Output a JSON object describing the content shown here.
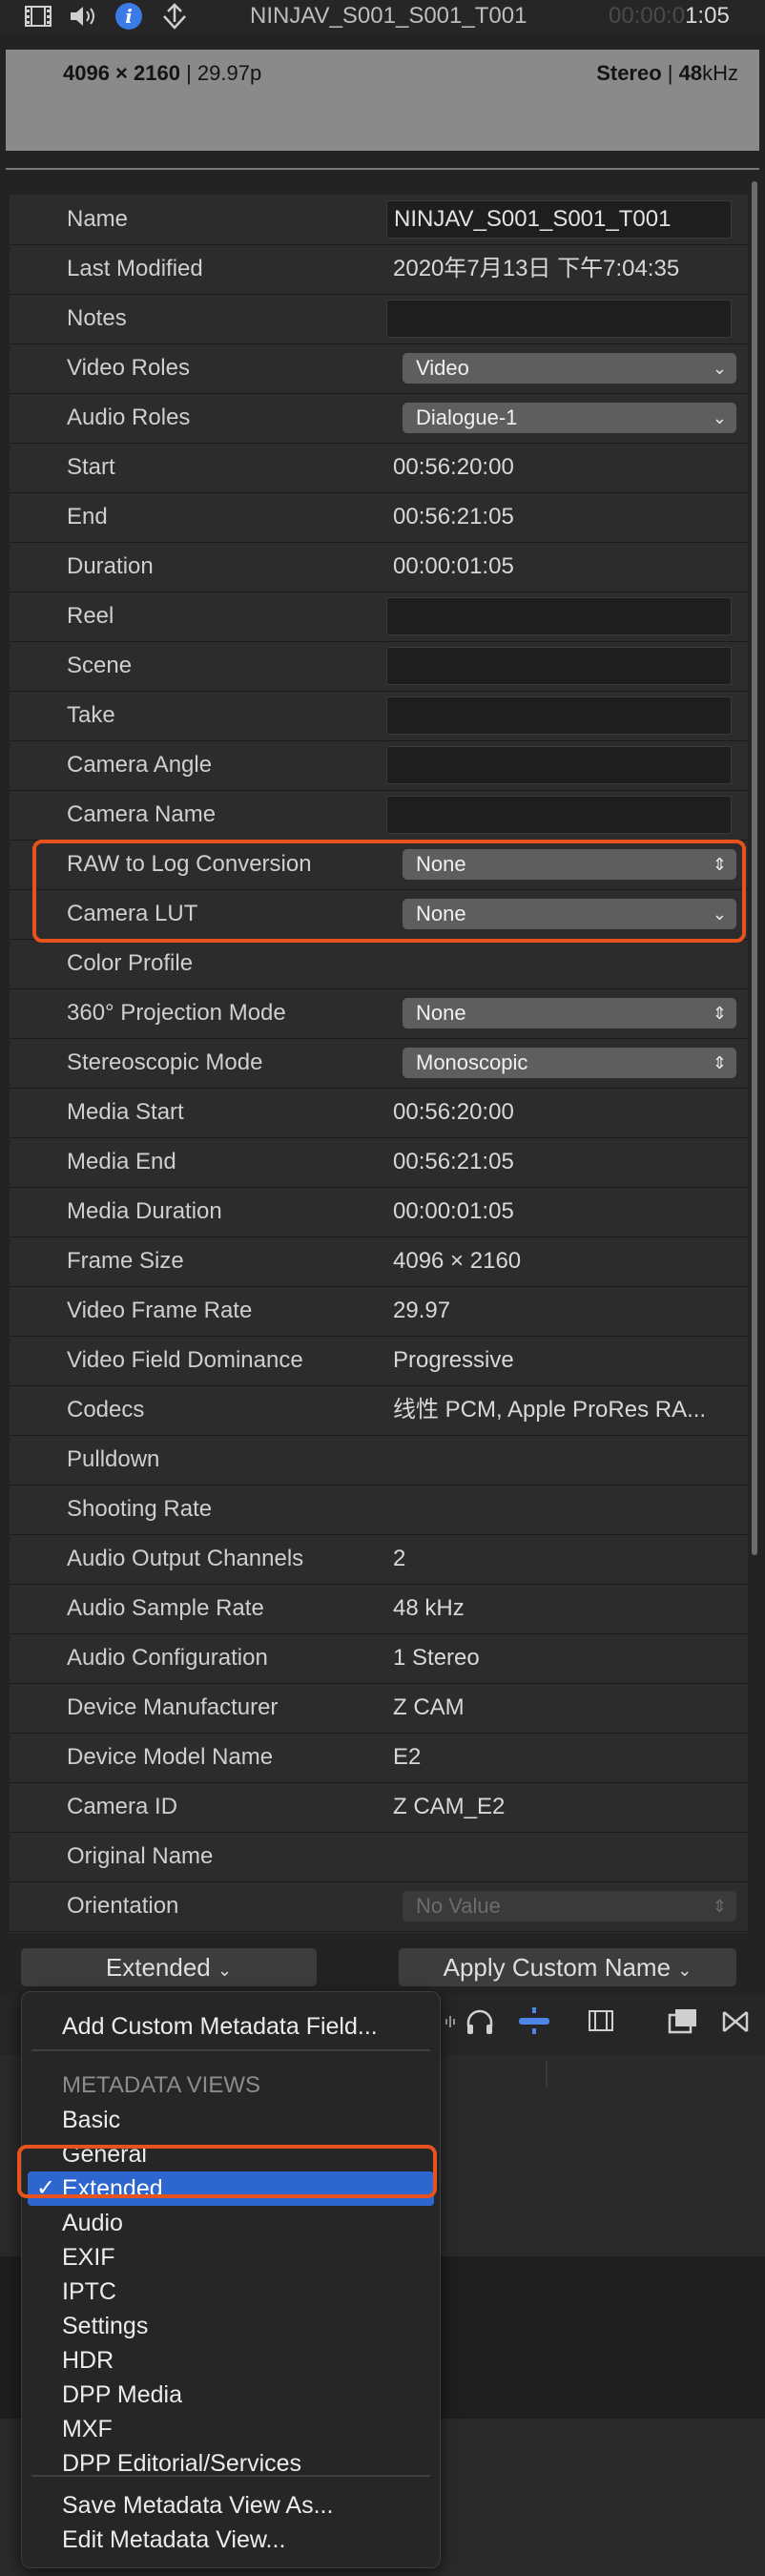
{
  "toolbar": {
    "icons": [
      "film-icon",
      "speaker-icon",
      "info-icon",
      "share-icon"
    ],
    "clip_name": "NINJAV_S001_S001_T001",
    "timecode_dim": "00:00:0",
    "timecode_bright": "1:05"
  },
  "header": {
    "frame_size": "4096 × 2160",
    "frame_rate": "29.97p",
    "audio_layout": "Stereo",
    "audio_rate_value": "48",
    "audio_rate_unit": "kHz"
  },
  "inspector": {
    "rows": [
      {
        "label": "Name",
        "value": "NINJAV_S001_S001_T001"
      },
      {
        "label": "Last Modified",
        "value": "2020年7月13日 下午7:04:35"
      },
      {
        "label": "Notes",
        "value": ""
      },
      {
        "label": "Video Roles",
        "value": "Video"
      },
      {
        "label": "Audio Roles",
        "value": "Dialogue-1"
      },
      {
        "label": "Start",
        "value": "00:56:20:00"
      },
      {
        "label": "End",
        "value": "00:56:21:05"
      },
      {
        "label": "Duration",
        "value": "00:00:01:05"
      },
      {
        "label": "Reel",
        "value": ""
      },
      {
        "label": "Scene",
        "value": ""
      },
      {
        "label": "Take",
        "value": ""
      },
      {
        "label": "Camera Angle",
        "value": ""
      },
      {
        "label": "Camera Name",
        "value": ""
      },
      {
        "label": "RAW to Log Conversion",
        "value": "None"
      },
      {
        "label": "Camera LUT",
        "value": "None"
      },
      {
        "label": "Color Profile",
        "value": ""
      },
      {
        "label": "360° Projection Mode",
        "value": "None"
      },
      {
        "label": "Stereoscopic Mode",
        "value": "Monoscopic"
      },
      {
        "label": "Media Start",
        "value": "00:56:20:00"
      },
      {
        "label": "Media End",
        "value": "00:56:21:05"
      },
      {
        "label": "Media Duration",
        "value": "00:00:01:05"
      },
      {
        "label": "Frame Size",
        "value": "4096 × 2160"
      },
      {
        "label": "Video Frame Rate",
        "value": "29.97"
      },
      {
        "label": "Video Field Dominance",
        "value": "Progressive"
      },
      {
        "label": "Codecs",
        "value": "线性 PCM, Apple ProRes RA..."
      },
      {
        "label": "Pulldown",
        "value": ""
      },
      {
        "label": "Shooting Rate",
        "value": ""
      },
      {
        "label": "Audio Output Channels",
        "value": "2"
      },
      {
        "label": "Audio Sample Rate",
        "value": "48 kHz"
      },
      {
        "label": "Audio Configuration",
        "value": "1 Stereo"
      },
      {
        "label": "Device Manufacturer",
        "value": "Z CAM"
      },
      {
        "label": "Device Model Name",
        "value": "E2"
      },
      {
        "label": "Camera ID",
        "value": "Z CAM_E2"
      },
      {
        "label": "Original Name",
        "value": ""
      },
      {
        "label": "Orientation",
        "value": "No Value"
      }
    ]
  },
  "bottom": {
    "view_button": "Extended",
    "apply_button": "Apply Custom Name"
  },
  "menu": {
    "add_field": "Add Custom Metadata Field...",
    "section_header": "METADATA VIEWS",
    "views": [
      "Basic",
      "General",
      "Extended",
      "Audio",
      "EXIF",
      "IPTC",
      "Settings",
      "HDR",
      "DPP Media",
      "MXF",
      "DPP Editorial/Services"
    ],
    "selected": "Extended",
    "check_mark": "✓",
    "save_view": "Save Metadata View As...",
    "edit_view": "Edit Metadata View..."
  },
  "colors": {
    "highlight": "#e8521f",
    "menu_selection": "#2d66cf"
  }
}
